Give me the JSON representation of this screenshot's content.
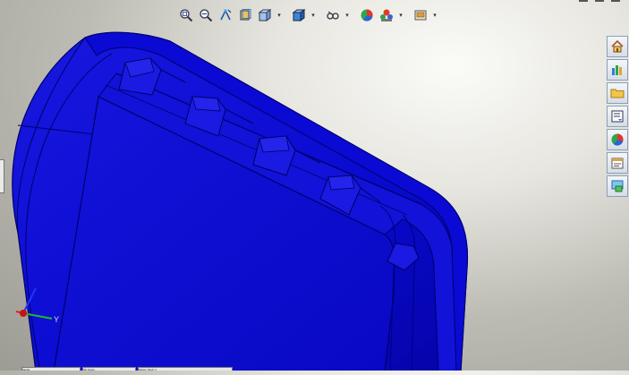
{
  "viewport": {
    "model_color": "#0a0ad8",
    "triad": {
      "y_label": "Y"
    }
  },
  "heads_up_toolbar": {
    "buttons": [
      {
        "name": "zoom-to-fit",
        "icon": "zoom-to-fit-icon"
      },
      {
        "name": "zoom-to-area",
        "icon": "zoom-to-area-icon"
      },
      {
        "name": "previous-view",
        "icon": "previous-view-icon"
      },
      {
        "name": "section-view",
        "icon": "section-view-icon"
      },
      {
        "name": "view-orientation",
        "icon": "view-orientation-icon"
      },
      {
        "name": "display-style",
        "icon": "display-style-icon"
      },
      {
        "name": "hide-show-items",
        "icon": "hide-show-icon"
      },
      {
        "name": "edit-appearance",
        "icon": "edit-appearance-icon"
      },
      {
        "name": "apply-scene",
        "icon": "apply-scene-icon"
      },
      {
        "name": "view-settings",
        "icon": "view-settings-icon"
      }
    ]
  },
  "task_pane": {
    "tabs": [
      {
        "name": "solidworks-resources",
        "icon": "home-icon"
      },
      {
        "name": "design-library",
        "icon": "design-library-icon"
      },
      {
        "name": "file-explorer",
        "icon": "folder-icon"
      },
      {
        "name": "view-palette",
        "icon": "view-palette-icon"
      },
      {
        "name": "appearances-scenes",
        "icon": "appearances-icon"
      },
      {
        "name": "custom-properties",
        "icon": "custom-properties-icon"
      },
      {
        "name": "solidworks-forum",
        "icon": "forum-icon"
      }
    ]
  },
  "bottom_tabs": {
    "tabs": [
      "Model",
      "3D Views",
      "Motion Study 1"
    ]
  }
}
